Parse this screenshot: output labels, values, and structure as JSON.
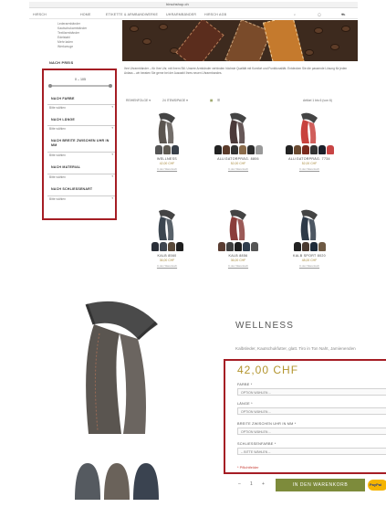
{
  "browser": {
    "url": "hirschshop.ch"
  },
  "nav": {
    "items": [
      "HIRSCH",
      "HOME",
      "ETIKETTE & ARMBANDWERKE",
      "UHRARMBÄNDER",
      "HIRSCH AGB"
    ],
    "icons": [
      "search-icon",
      "user-icon",
      "cart-icon"
    ]
  },
  "sidebar": {
    "links": [
      "Lederarmbänder",
      "Kautschukarmbänder",
      "Textilarmbänder",
      "Edelstahl",
      "Mehr laden",
      "Werkzeuge"
    ],
    "section_title": "NACH PREIS",
    "price_range": "0 – 105",
    "filters": [
      {
        "heading": "NACH FARBE",
        "select": "Bitte wählen"
      },
      {
        "heading": "NACH LÄNGE",
        "select": "Bitte wählen"
      },
      {
        "heading": "NACH BREITE ZWISCHEN UHR IN MM",
        "select": "Bitte wählen"
      },
      {
        "heading": "NACH MATERIAL",
        "select": "Bitte wählen"
      },
      {
        "heading": "NACH SCHLIESSENART",
        "select": "Bitte wählen"
      }
    ]
  },
  "category": {
    "description": "Ihre Uhrarmbänder – für Ihre Uhr, mit Ihrem Stil. Unsere Armbänder verbinden höchste Qualität mit Komfort und Funktionalität. Entdecken Sie die passende Lösung für jeden Anlass – wir beraten Sie gerne bei der Auswahl Ihres neuen Uhrarmbandes.",
    "sort_label": "REIHENFOLGE ▾",
    "per_page": "24 ITEMS/PAGE ▾",
    "count_text": "Artikel 1 bis 6 (von 6)"
  },
  "products": [
    {
      "name": "WELLNESS",
      "price": "42,00 CHF",
      "link": "In den Warenkorb",
      "strap_color": "#5b5550",
      "swatches": [
        "#555",
        "#5f5a52",
        "#38404a"
      ]
    },
    {
      "name": "ALLIGATORPRÄG. 8806",
      "price": "52,00 CHF",
      "link": "In den Warenkorb",
      "strap_color": "#4b3a3a",
      "swatches": [
        "#222",
        "#5b3b2a",
        "#333",
        "#8a6b4a",
        "#2d2d2d",
        "#999"
      ]
    },
    {
      "name": "ALLIGATORPRÄG. 7734",
      "price": "52,00 CHF",
      "link": "In den Warenkorb",
      "strap_color": "#c8423e",
      "swatches": [
        "#222",
        "#6a4b32",
        "#7a2a1e",
        "#333",
        "#1b1f2a",
        "#c84444"
      ]
    },
    {
      "name": "KALB 8560",
      "price": "36,00 CHF",
      "link": "In den Warenkorb",
      "strap_color": "#3c4650",
      "swatches": [
        "#2a2f38",
        "#3f4650",
        "#5a4a3a",
        "#1e1e1e"
      ]
    },
    {
      "name": "KALB 8856",
      "price": "36,00 CHF",
      "link": "In den Warenkorb",
      "strap_color": "#8a3d3a",
      "swatches": [
        "#5a3d32",
        "#3f3f3f",
        "#1c1c1c",
        "#2f3d4d",
        "#555"
      ]
    },
    {
      "name": "KALB SPORT 8020",
      "price": "48,00 CHF",
      "link": "In den Warenkorb",
      "strap_color": "#2e3a48",
      "swatches": [
        "#222",
        "#4a3a30",
        "#1e2b3a",
        "#6e5a44"
      ]
    }
  ],
  "detail": {
    "title": "WELLNESS",
    "subtitle": "Kalbsleder, Kautschukfutter, glatt. Tiro in Ton Naht, Jamienenden",
    "price": "42,00 CHF",
    "options": [
      {
        "label": "FARBE *",
        "value": "OPTION WÄHLEN ..."
      },
      {
        "label": "LÄNGE *",
        "value": "OPTION WÄHLEN ..."
      },
      {
        "label": "BREITE ZWISCHEN UHR IN MM *",
        "value": "OPTION WÄHLEN ..."
      },
      {
        "label": "SCHLIESSENFARBE *",
        "value": "-- BITTE WÄHLEN --"
      }
    ],
    "required_note": "* Pflichtfelder",
    "qty_minus": "–",
    "qty_value": "1",
    "qty_plus": "+",
    "cart_label": "IN DEN WARENKORB",
    "paypal_label": "PayPal"
  },
  "colors": {
    "accent_red": "#a51d24",
    "price_gold": "#b3952f",
    "cart_green": "#7d8b3b"
  }
}
